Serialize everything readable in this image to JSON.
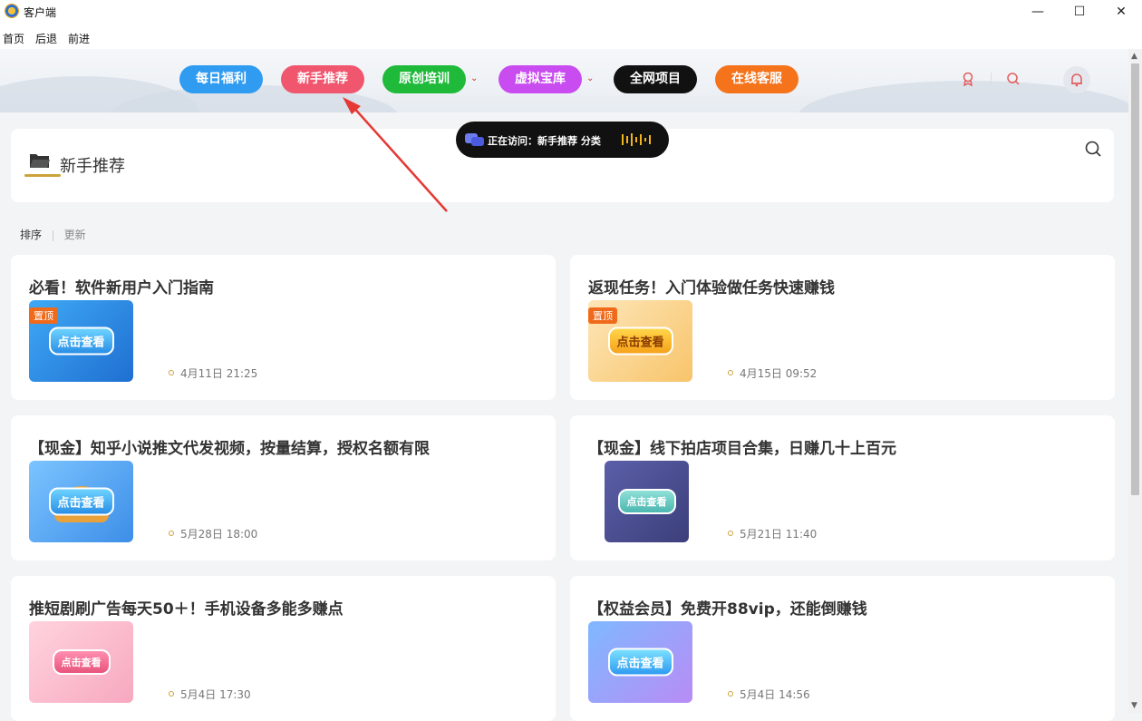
{
  "window": {
    "title": "客户端",
    "minimize": "—",
    "maximize": "☐",
    "close": "✕"
  },
  "menu": [
    "首页",
    "后退",
    "前进"
  ],
  "nav": [
    {
      "label": "每日福利",
      "color": "#2f9bf1"
    },
    {
      "label": "新手推荐",
      "color": "#f0566e"
    },
    {
      "label": "原创培训",
      "color": "#1fba3a"
    },
    {
      "label": "虚拟宝库",
      "color": "#c94cf0"
    },
    {
      "label": "全网项目",
      "color": "#111111"
    },
    {
      "label": "在线客服",
      "color": "#f5731b"
    }
  ],
  "header_icons": {
    "award": "award-icon",
    "search": "search-icon",
    "bell": "bell-icon"
  },
  "visiting": {
    "text": "正在访问：新手推荐 分类"
  },
  "category": {
    "title": "新手推荐"
  },
  "sort": {
    "label": "排序",
    "option": "更新"
  },
  "cards": [
    {
      "title": "必看！软件新用户入门指南",
      "date": "4月11日 21:25",
      "pinned": "置顶",
      "thumb_label": "点击查看"
    },
    {
      "title": "返现任务！入门体验做任务快速赚钱",
      "date": "4月15日 09:52",
      "pinned": "置顶",
      "thumb_label": "点击查看"
    },
    {
      "title": "【现金】知乎小说推文代发视频，按量结算，授权名额有限",
      "date": "5月28日 18:00",
      "pinned": "",
      "thumb_label": "点击查看"
    },
    {
      "title": "【现金】线下拍店项目合集，日赚几十上百元",
      "date": "5月21日 11:40",
      "pinned": "",
      "thumb_label": "点击查看"
    },
    {
      "title": "推短剧刷广告每天50＋！手机设备多能多赚点",
      "date": "5月4日 17:30",
      "pinned": "",
      "thumb_label": "点击查看"
    },
    {
      "title": "【权益会员】免费开88vip，还能倒赚钱",
      "date": "5月4日 14:56",
      "pinned": "",
      "thumb_label": "点击查看"
    }
  ]
}
